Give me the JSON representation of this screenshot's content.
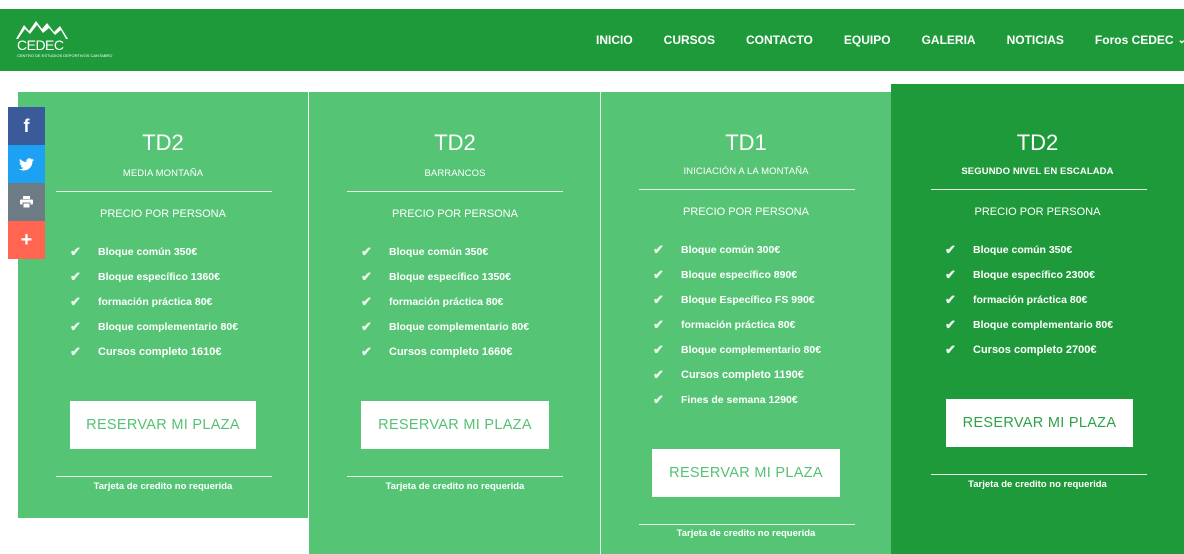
{
  "header": {
    "logo_text": "CEDEC",
    "logo_subtext": "CENTRO DE ESTUDIOS DEPORTIVOS CANTABRO",
    "nav": [
      "INICIO",
      "CURSOS",
      "CONTACTO",
      "EQUIPO",
      "GALERIA",
      "NOTICIAS",
      "Foros CEDEC"
    ],
    "colors": {
      "bar": "#1f9a3b"
    }
  },
  "social": {
    "items": [
      {
        "icon": "facebook-icon",
        "glyph": "f",
        "color": "#3b5a9a"
      },
      {
        "icon": "twitter-icon",
        "color": "#1da1f2"
      },
      {
        "icon": "print-icon",
        "color": "#6d7b84"
      },
      {
        "icon": "plus-icon",
        "glyph": "+",
        "color": "#ff6550"
      }
    ]
  },
  "cards": [
    {
      "title": "TD2",
      "subtitle": "MEDIA MONTAÑA",
      "price_label": "PRECIO POR PERSONA",
      "features": [
        "Bloque común 350€",
        "Bloque específico 1360€",
        "formación práctica 80€",
        "Bloque complementario 80€",
        "Cursos completo 1610€"
      ],
      "button": "RESERVAR MI PLAZA",
      "footer": "Tarjeta de credito no requerida"
    },
    {
      "title": "TD2",
      "subtitle": "BARRANCOS",
      "price_label": "PRECIO POR PERSONA",
      "features": [
        "Bloque común 350€",
        "Bloque específico 1350€",
        "formación práctica 80€",
        "Bloque complementario 80€",
        "Cursos completo 1660€"
      ],
      "button": "RESERVAR MI PLAZA",
      "footer": "Tarjeta de credito no requerida"
    },
    {
      "title": "TD1",
      "subtitle": "INICIACIÓN A LA MONTAÑA",
      "price_label": "PRECIO POR PERSONA",
      "features": [
        "Bloque común 300€",
        "Bloque específico 890€",
        "Bloque Específico FS 990€",
        "formación práctica 80€",
        "Bloque complementario 80€",
        "Cursos completo 1190€",
        "Fines de semana 1290€"
      ],
      "button": "RESERVAR MI PLAZA",
      "footer": "Tarjeta de credito no requerida"
    },
    {
      "title": "TD2",
      "subtitle": "SEGUNDO NIVEL EN ESCALADA",
      "price_label": "PRECIO POR PERSONA",
      "features": [
        "Bloque común 350€",
        "Bloque específico 2300€",
        "formación práctica 80€",
        "Bloque complementario 80€",
        "Cursos completo 2700€"
      ],
      "button": "RESERVAR MI PLAZA",
      "footer": "Tarjeta de credito no requerida"
    }
  ],
  "colors": {
    "card": "#55c475",
    "featured": "#1f9a3b",
    "button_text": "#54c273"
  }
}
